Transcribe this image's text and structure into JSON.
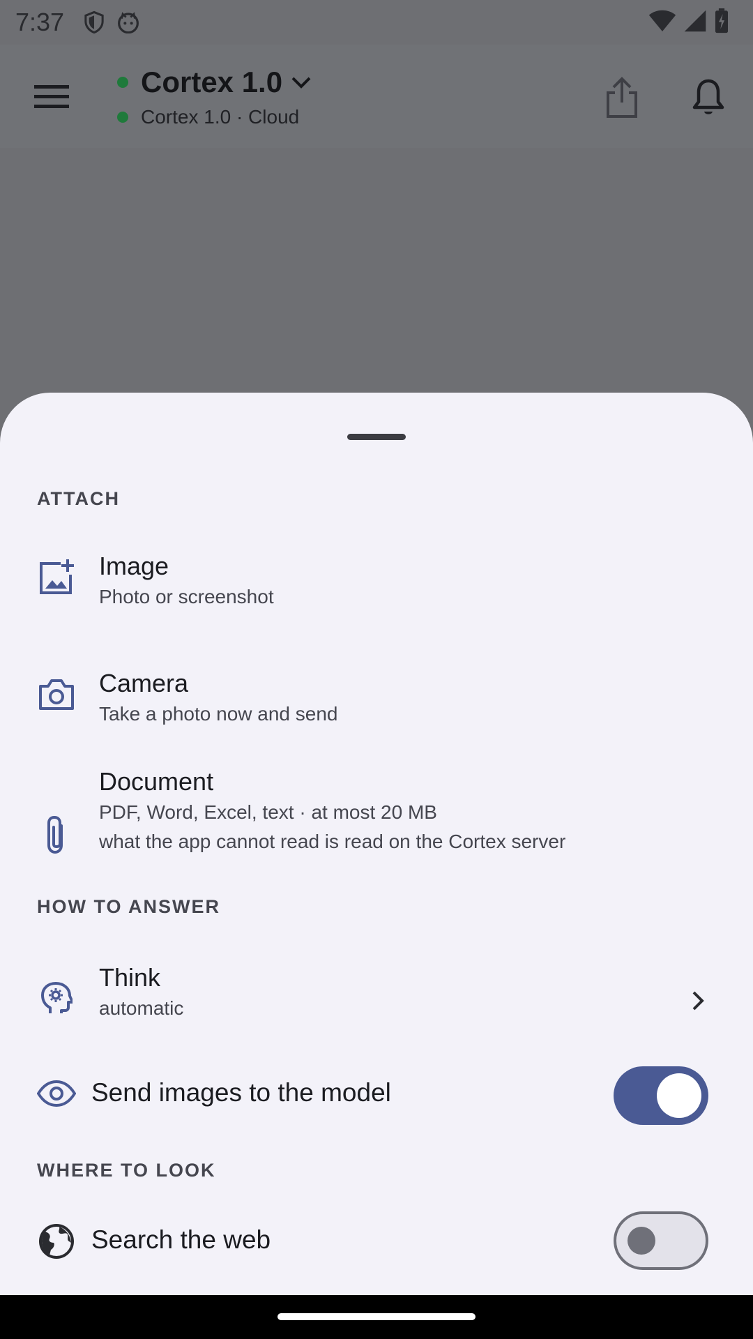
{
  "status": {
    "time": "7:37"
  },
  "appbar": {
    "title": "Cortex 1.0",
    "subtitle": "Cortex 1.0 · Cloud",
    "status_color": "#1f7a3b"
  },
  "sheet": {
    "sections": {
      "attach": "ATTACH",
      "how": "HOW TO ANSWER",
      "where": "WHERE TO LOOK"
    },
    "image": {
      "title": "Image",
      "subtitle": "Photo or screenshot",
      "icon": "add-photo-icon"
    },
    "camera": {
      "title": "Camera",
      "subtitle": "Take a photo now and send",
      "icon": "camera-icon"
    },
    "document": {
      "title": "Document",
      "subtitle1": "PDF, Word, Excel, text · at most 20 MB",
      "subtitle2": "what the app cannot read is read on the Cortex server",
      "icon": "paperclip-icon"
    },
    "think": {
      "title": "Think",
      "subtitle": "automatic",
      "icon": "psychology-icon"
    },
    "send_images": {
      "label": "Send images to the model",
      "enabled": true,
      "icon": "eye-icon"
    },
    "search_web": {
      "label": "Search the web",
      "enabled": false,
      "icon": "globe-icon"
    }
  },
  "colors": {
    "accent": "#4a5a94",
    "sheet_bg": "#f3f2f9",
    "scrim": "#6e6f73"
  }
}
